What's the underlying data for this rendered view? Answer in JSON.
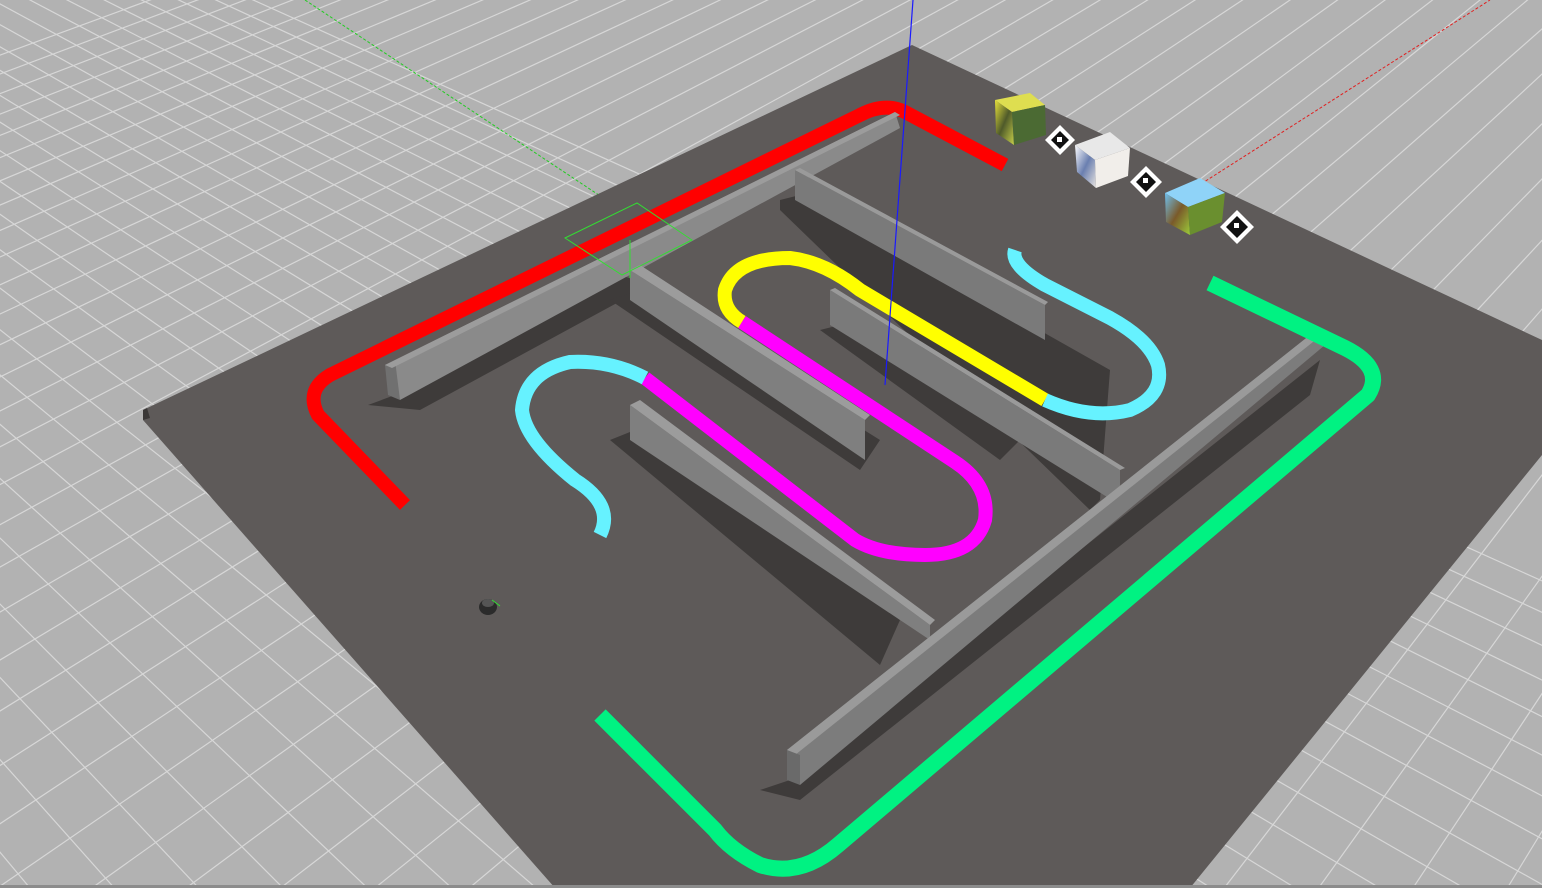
{
  "viewport": {
    "background_color": "#b2b2b2",
    "grid_line_color": "#d6d6d6",
    "ground_plane_color": "#5e5a59"
  },
  "axes": {
    "x_axis_color": "#e02020",
    "y_axis_color": "#22cc22",
    "z_axis_color": "#1a1aff"
  },
  "tracks": [
    {
      "name": "red-track",
      "color": "#ff0000"
    },
    {
      "name": "yellow-track",
      "color": "#ffff00"
    },
    {
      "name": "magenta-track",
      "color": "#ff00ff"
    },
    {
      "name": "cyan-track",
      "color": "#66f2ff"
    },
    {
      "name": "green-track",
      "color": "#00f282"
    }
  ],
  "objects": {
    "walls_color": "#8a8a8a",
    "selection_box_color": "#33dd33",
    "image_cubes": 3,
    "aruco_markers": 3,
    "robot": "turtlebot"
  }
}
